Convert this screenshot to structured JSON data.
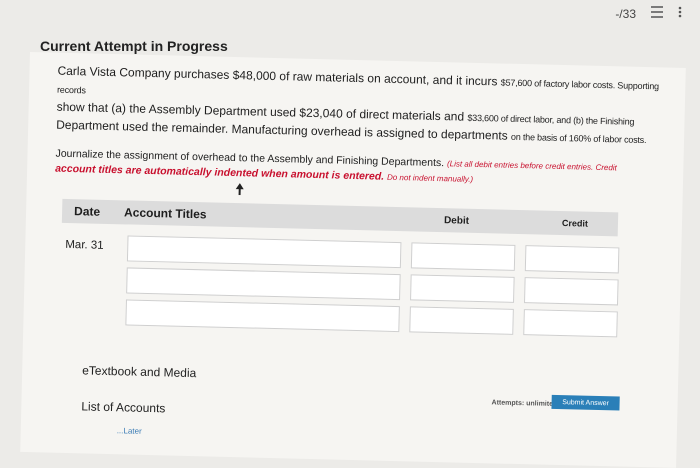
{
  "topbar": {
    "score": "-/33",
    "list_icon": "list-icon",
    "more_icon": "more-vert-icon"
  },
  "progress_title": "Current Attempt in Progress",
  "problem": {
    "line1_a": "Carla Vista Company purchases $48,000 of raw materials on account, and it incurs ",
    "line1_b": "$57,600 of factory labor costs. Supporting records",
    "line2_a": "show that (a) the Assembly Department used $23,040 of direct materials and ",
    "line2_b": "$33,600 of direct labor, and (b) the Finishing",
    "line3_a": "Department used the remainder. Manufacturing overhead is assigned to departments ",
    "line3_b": "on the basis of 160% of labor costs."
  },
  "instruction": {
    "main": "Journalize the assignment of overhead to the Assembly and Finishing Departments. ",
    "small": "(List all debit entries before credit entries. Credit",
    "red_a": "account titles are automatically indented when amount is entered. ",
    "red_b": "Do not indent manually.)"
  },
  "table": {
    "headers": {
      "date": "Date",
      "account": "Account Titles",
      "debit": "Debit",
      "credit": "Credit"
    },
    "row_date": "Mar. 31"
  },
  "links": {
    "etextbook": "eTextbook and Media",
    "accounts": "List of Accounts",
    "later": "...Later"
  },
  "footer": {
    "attempts": "Attempts: unlimited",
    "submit": "Submit Answer"
  }
}
